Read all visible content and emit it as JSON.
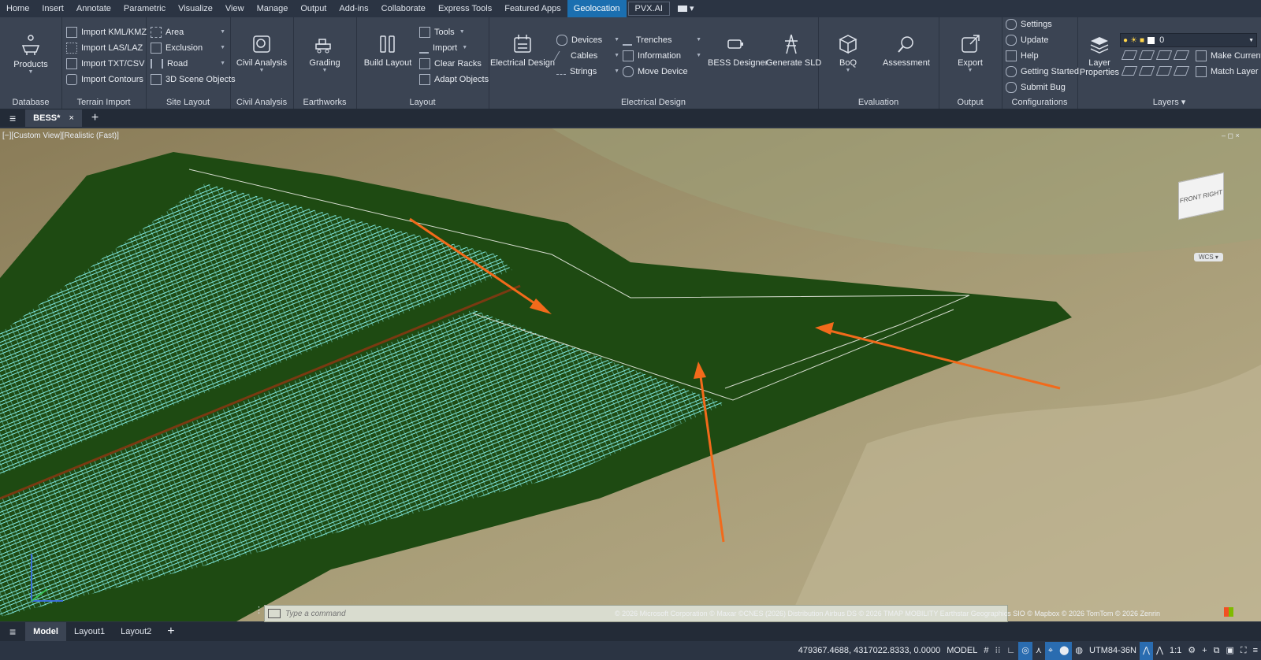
{
  "menubar": {
    "tabs": [
      "Home",
      "Insert",
      "Annotate",
      "Parametric",
      "Visualize",
      "View",
      "Manage",
      "Output",
      "Add-ins",
      "Collaborate",
      "Express Tools",
      "Featured Apps",
      "Geolocation",
      "PVX.AI"
    ],
    "active": "Geolocation"
  },
  "ribbon": {
    "database": {
      "label": "Database",
      "products": "Products"
    },
    "terrain_import": {
      "label": "Terrain Import",
      "items": [
        "Import KML/KMZ",
        "Import LAS/LAZ",
        "Import TXT/CSV",
        "Import Contours"
      ]
    },
    "site_layout": {
      "label": "Site Layout",
      "items": [
        "Area",
        "Exclusion",
        "Road",
        "3D Scene Objects"
      ]
    },
    "civil_analysis": {
      "label": "Civil Analysis",
      "button": "Civil Analysis"
    },
    "earthworks": {
      "label": "Earthworks",
      "button": "Grading"
    },
    "layout": {
      "label": "Layout",
      "button": "Build Layout",
      "items": [
        "Tools",
        "Import",
        "Clear Racks",
        "Adapt Objects"
      ]
    },
    "electrical": {
      "label": "Electrical Design",
      "button": "Electrical Design",
      "col1": [
        "Devices",
        "Cables",
        "Strings"
      ],
      "col2": [
        "Trenches",
        "Information",
        "Move Device"
      ],
      "bess": "BESS Designer",
      "sld": "Generate SLD"
    },
    "evaluation": {
      "label": "Evaluation",
      "boq": "BoQ",
      "assessment": "Assessment"
    },
    "output": {
      "label": "Output",
      "export": "Export"
    },
    "configurations": {
      "label": "Configurations",
      "items": [
        "Settings",
        "Update",
        "Help",
        "Getting Started",
        "Submit Bug"
      ]
    },
    "layers": {
      "label": "Layers",
      "layer_properties": "Layer Properties",
      "current_layer": "0",
      "make_current": "Make Current",
      "match_layer": "Match Layer"
    }
  },
  "tabbar": {
    "doc_tab": "BESS*"
  },
  "viewport": {
    "view_label": "[−][Custom View][Realistic (Fast)]",
    "viewcube_front": "FRONT",
    "viewcube_right": "RIGHT",
    "wcs": "WCS",
    "cmd_placeholder": "Type a command",
    "copyright": "© 2026 Microsoft Corporation © Maxar ©CNES (2026) Distribution Airbus DS © 2026 TMAP MOBILITY Earthstar Geographics SIO © Mapbox © 2026 TomTom © 2026 Zenrin"
  },
  "layout_tabs": [
    "Model",
    "Layout1",
    "Layout2"
  ],
  "status": {
    "coords": "479367.4688, 4317022.8333, 0.0000",
    "model": "MODEL",
    "crs": "UTM84-36N",
    "scale": "1:1"
  },
  "colors": {
    "ribbon": "#3b4453",
    "active_tab": "#1b6fb0",
    "arrow": "#f26a1b",
    "site_green": "#1e4a12",
    "rack": "#7fe8e0"
  }
}
